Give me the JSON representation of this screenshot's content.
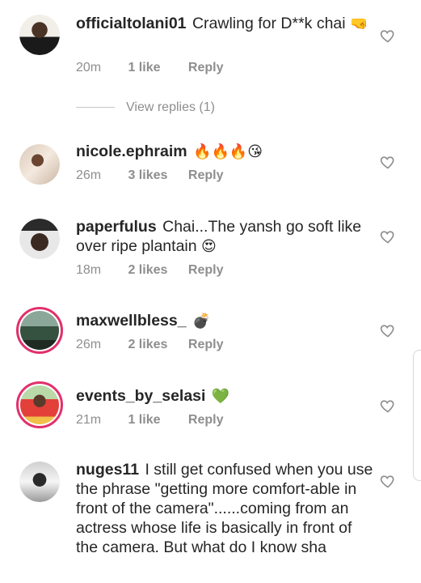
{
  "comments": [
    {
      "username": "officialtolani01",
      "text": "Crawling for D**k chai",
      "emoji": "🤜",
      "time": "20m",
      "likes": "1 like",
      "reply": "Reply"
    },
    {
      "username": "nicole.ephraim",
      "text": "",
      "emoji": "🔥🔥🔥😘",
      "time": "26m",
      "likes": "3 likes",
      "reply": "Reply"
    },
    {
      "username": "paperfulus",
      "text": "Chai...The yansh go soft like over ripe plantain",
      "emoji": "😍",
      "time": "18m",
      "likes": "2 likes",
      "reply": "Reply"
    },
    {
      "username": "maxwellbless_",
      "text": "",
      "emoji": "💣",
      "time": "26m",
      "likes": "2 likes",
      "reply": "Reply"
    },
    {
      "username": "events_by_selasi",
      "text": "",
      "emoji": "💚",
      "time": "21m",
      "likes": "1 like",
      "reply": "Reply"
    },
    {
      "username": "nuges11",
      "text": "I still get confused when you use the phrase \"getting more comfort-able in front of the camera\"......coming from an actress whose life is basically in front of the camera. But what do I know sha",
      "emoji": "",
      "time": "",
      "likes": "",
      "reply": ""
    }
  ],
  "view_replies": "View replies (1)",
  "colors": {
    "text": "#262626",
    "muted": "#8e8e8e",
    "story_ring": "#e1306c"
  },
  "icons": {
    "like": "heart-outline-icon"
  }
}
